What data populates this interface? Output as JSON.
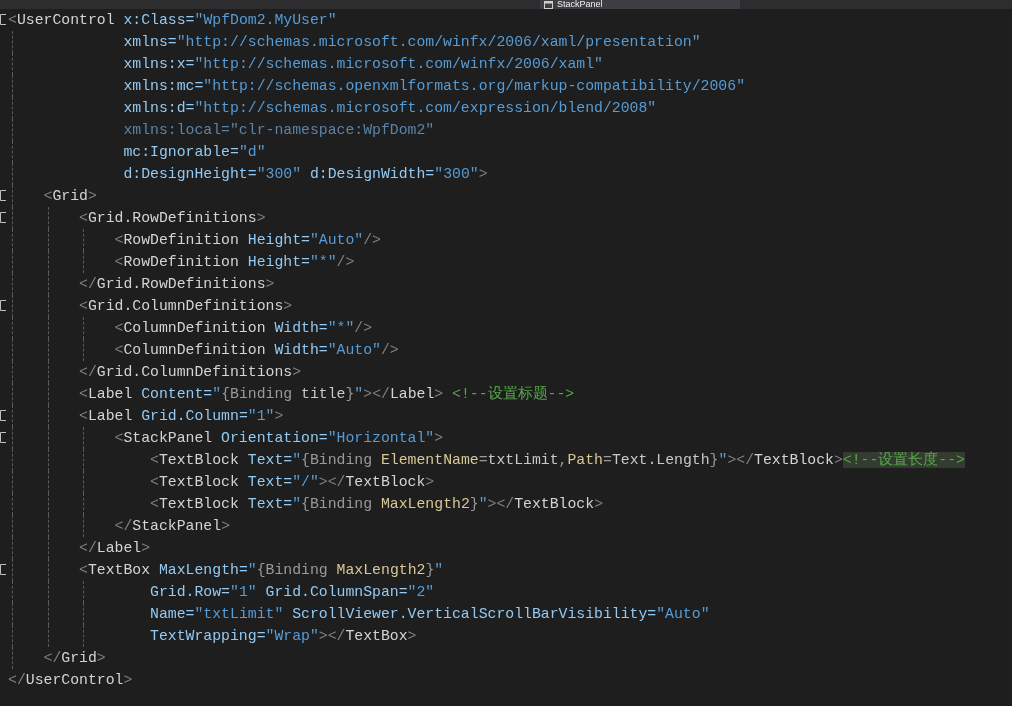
{
  "document_tab": {
    "label": "StackPanel"
  },
  "lines": [
    {
      "expanded": true,
      "tokens": [
        {
          "kind": "punct",
          "text": "<"
        },
        {
          "kind": "tag",
          "text": "UserControl"
        },
        {
          "kind": "attr",
          "text": " x:Class="
        },
        {
          "kind": "value",
          "text": "\"WpfDom2.MyUser\""
        }
      ]
    },
    {
      "tokens": [
        {
          "kind": "attr",
          "text": "             xmlns="
        },
        {
          "kind": "value",
          "text": "\"http://schemas.microsoft.com/winfx/2006/xaml/presentation\""
        }
      ]
    },
    {
      "tokens": [
        {
          "kind": "attr",
          "text": "             xmlns:x="
        },
        {
          "kind": "value",
          "text": "\"http://schemas.microsoft.com/winfx/2006/xaml\""
        }
      ]
    },
    {
      "tokens": [
        {
          "kind": "attr",
          "text": "             xmlns:mc="
        },
        {
          "kind": "value",
          "text": "\"http://schemas.openxmlformats.org/markup-compatibility/2006\""
        }
      ]
    },
    {
      "tokens": [
        {
          "kind": "attr",
          "text": "             xmlns:d="
        },
        {
          "kind": "value",
          "text": "\"http://schemas.microsoft.com/expression/blend/2008\""
        }
      ]
    },
    {
      "tokens": [
        {
          "kind": "unused",
          "text": "             xmlns:local=\"clr-namespace:WpfDom2\""
        }
      ]
    },
    {
      "tokens": [
        {
          "kind": "attr",
          "text": "             mc:Ignorable="
        },
        {
          "kind": "value",
          "text": "\"d\""
        }
      ]
    },
    {
      "tokens": [
        {
          "kind": "attr",
          "text": "             d:DesignHeight="
        },
        {
          "kind": "value",
          "text": "\"300\""
        },
        {
          "kind": "attr",
          "text": " d:DesignWidth="
        },
        {
          "kind": "value",
          "text": "\"300\""
        },
        {
          "kind": "punct",
          "text": ">"
        }
      ]
    },
    {
      "expanded": true,
      "tokens": [
        {
          "kind": "punct",
          "text": "    <"
        },
        {
          "kind": "tag",
          "text": "Grid"
        },
        {
          "kind": "punct",
          "text": ">"
        }
      ]
    },
    {
      "expanded": true,
      "tokens": [
        {
          "kind": "punct",
          "text": "        <"
        },
        {
          "kind": "tag",
          "text": "Grid.RowDefinitions"
        },
        {
          "kind": "punct",
          "text": ">"
        }
      ]
    },
    {
      "tokens": [
        {
          "kind": "punct",
          "text": "            <"
        },
        {
          "kind": "tag",
          "text": "RowDefinition"
        },
        {
          "kind": "attr",
          "text": " Height="
        },
        {
          "kind": "value",
          "text": "\"Auto\""
        },
        {
          "kind": "punct",
          "text": "/>"
        }
      ]
    },
    {
      "tokens": [
        {
          "kind": "punct",
          "text": "            <"
        },
        {
          "kind": "tag",
          "text": "RowDefinition"
        },
        {
          "kind": "attr",
          "text": " Height="
        },
        {
          "kind": "value",
          "text": "\"*\""
        },
        {
          "kind": "punct",
          "text": "/>"
        }
      ]
    },
    {
      "tokens": [
        {
          "kind": "punct",
          "text": "        </"
        },
        {
          "kind": "tag",
          "text": "Grid.RowDefinitions"
        },
        {
          "kind": "punct",
          "text": ">"
        }
      ]
    },
    {
      "expanded": true,
      "tokens": [
        {
          "kind": "punct",
          "text": "        <"
        },
        {
          "kind": "tag",
          "text": "Grid.ColumnDefinitions"
        },
        {
          "kind": "punct",
          "text": ">"
        }
      ]
    },
    {
      "tokens": [
        {
          "kind": "punct",
          "text": "            <"
        },
        {
          "kind": "tag",
          "text": "ColumnDefinition"
        },
        {
          "kind": "attr",
          "text": " Width="
        },
        {
          "kind": "value",
          "text": "\"*\""
        },
        {
          "kind": "punct",
          "text": "/>"
        }
      ]
    },
    {
      "tokens": [
        {
          "kind": "punct",
          "text": "            <"
        },
        {
          "kind": "tag",
          "text": "ColumnDefinition"
        },
        {
          "kind": "attr",
          "text": " Width="
        },
        {
          "kind": "value",
          "text": "\"Auto\""
        },
        {
          "kind": "punct",
          "text": "/>"
        }
      ]
    },
    {
      "tokens": [
        {
          "kind": "punct",
          "text": "        </"
        },
        {
          "kind": "tag",
          "text": "Grid.ColumnDefinitions"
        },
        {
          "kind": "punct",
          "text": ">"
        }
      ]
    },
    {
      "tokens": [
        {
          "kind": "punct",
          "text": "        <"
        },
        {
          "kind": "tag",
          "text": "Label"
        },
        {
          "kind": "attr",
          "text": " Content="
        },
        {
          "kind": "value",
          "text": "\""
        },
        {
          "kind": "markup",
          "text": "{Binding"
        },
        {
          "kind": "markup_value",
          "text": " title"
        },
        {
          "kind": "markup",
          "text": "}"
        },
        {
          "kind": "value",
          "text": "\""
        },
        {
          "kind": "punct",
          "text": "></"
        },
        {
          "kind": "tag",
          "text": "Label"
        },
        {
          "kind": "punct",
          "text": ">"
        },
        {
          "kind": "comment",
          "text": " <!--设置标题-->"
        }
      ]
    },
    {
      "expanded": true,
      "tokens": [
        {
          "kind": "punct",
          "text": "        <"
        },
        {
          "kind": "tag",
          "text": "Label"
        },
        {
          "kind": "attr",
          "text": " Grid.Column="
        },
        {
          "kind": "value",
          "text": "\"1\""
        },
        {
          "kind": "punct",
          "text": ">"
        }
      ]
    },
    {
      "expanded": true,
      "tokens": [
        {
          "kind": "punct",
          "text": "            <"
        },
        {
          "kind": "tag",
          "text": "StackPanel"
        },
        {
          "kind": "attr",
          "text": " Orientation="
        },
        {
          "kind": "value",
          "text": "\"Horizontal\""
        },
        {
          "kind": "punct",
          "text": ">"
        }
      ]
    },
    {
      "tokens": [
        {
          "kind": "punct",
          "text": "                <"
        },
        {
          "kind": "tag",
          "text": "TextBlock"
        },
        {
          "kind": "attr",
          "text": " Text="
        },
        {
          "kind": "value",
          "text": "\""
        },
        {
          "kind": "markup",
          "text": "{Binding"
        },
        {
          "kind": "markup_property",
          "text": " ElementName"
        },
        {
          "kind": "markup",
          "text": "="
        },
        {
          "kind": "markup_value",
          "text": "txtLimit"
        },
        {
          "kind": "markup",
          "text": ","
        },
        {
          "kind": "markup_property",
          "text": "Path"
        },
        {
          "kind": "markup",
          "text": "="
        },
        {
          "kind": "markup_value",
          "text": "Text.Length"
        },
        {
          "kind": "markup",
          "text": "}"
        },
        {
          "kind": "value",
          "text": "\""
        },
        {
          "kind": "punct",
          "text": "></"
        },
        {
          "kind": "tag",
          "text": "TextBlock"
        },
        {
          "kind": "punct",
          "text": ">"
        },
        {
          "kind": "comment_highlighted",
          "text": "<!--设置长度-->"
        }
      ]
    },
    {
      "tokens": [
        {
          "kind": "punct",
          "text": "                <"
        },
        {
          "kind": "tag",
          "text": "TextBlock"
        },
        {
          "kind": "attr",
          "text": " Text="
        },
        {
          "kind": "value",
          "text": "\"/\""
        },
        {
          "kind": "punct",
          "text": "></"
        },
        {
          "kind": "tag",
          "text": "TextBlock"
        },
        {
          "kind": "punct",
          "text": ">"
        }
      ]
    },
    {
      "tokens": [
        {
          "kind": "punct",
          "text": "                <"
        },
        {
          "kind": "tag",
          "text": "TextBlock"
        },
        {
          "kind": "attr",
          "text": " Text="
        },
        {
          "kind": "value",
          "text": "\""
        },
        {
          "kind": "markup",
          "text": "{Binding"
        },
        {
          "kind": "markup_property",
          "text": " MaxLength2"
        },
        {
          "kind": "markup",
          "text": "}"
        },
        {
          "kind": "value",
          "text": "\""
        },
        {
          "kind": "punct",
          "text": "></"
        },
        {
          "kind": "tag",
          "text": "TextBlock"
        },
        {
          "kind": "punct",
          "text": ">"
        }
      ]
    },
    {
      "tokens": [
        {
          "kind": "punct",
          "text": "            </"
        },
        {
          "kind": "tag",
          "text": "StackPanel"
        },
        {
          "kind": "punct",
          "text": ">"
        }
      ]
    },
    {
      "tokens": [
        {
          "kind": "punct",
          "text": "        </"
        },
        {
          "kind": "tag",
          "text": "Label"
        },
        {
          "kind": "punct",
          "text": ">"
        }
      ]
    },
    {
      "expanded": true,
      "tokens": [
        {
          "kind": "punct",
          "text": "        <"
        },
        {
          "kind": "tag",
          "text": "TextBox"
        },
        {
          "kind": "attr",
          "text": " MaxLength="
        },
        {
          "kind": "value",
          "text": "\""
        },
        {
          "kind": "markup",
          "text": "{Binding"
        },
        {
          "kind": "markup_property",
          "text": " MaxLength2"
        },
        {
          "kind": "markup",
          "text": "}"
        },
        {
          "kind": "value",
          "text": "\""
        }
      ]
    },
    {
      "tokens": [
        {
          "kind": "attr",
          "text": "                Grid.Row="
        },
        {
          "kind": "value",
          "text": "\"1\""
        },
        {
          "kind": "attr",
          "text": " Grid.ColumnSpan="
        },
        {
          "kind": "value",
          "text": "\"2\""
        }
      ]
    },
    {
      "tokens": [
        {
          "kind": "attr",
          "text": "                Name="
        },
        {
          "kind": "value",
          "text": "\"txtLimit\""
        },
        {
          "kind": "attr",
          "text": " ScrollViewer.VerticalScrollBarVisibility="
        },
        {
          "kind": "value",
          "text": "\"Auto\""
        }
      ]
    },
    {
      "tokens": [
        {
          "kind": "attr",
          "text": "                TextWrapping="
        },
        {
          "kind": "value",
          "text": "\"Wrap\""
        },
        {
          "kind": "punct",
          "text": "></"
        },
        {
          "kind": "tag",
          "text": "TextBox"
        },
        {
          "kind": "punct",
          "text": ">"
        }
      ]
    },
    {
      "tokens": [
        {
          "kind": "punct",
          "text": "    </"
        },
        {
          "kind": "tag",
          "text": "Grid"
        },
        {
          "kind": "punct",
          "text": ">"
        }
      ]
    },
    {
      "tokens": [
        {
          "kind": "punct",
          "text": "</"
        },
        {
          "kind": "tag",
          "text": "UserControl"
        },
        {
          "kind": "punct",
          "text": ">"
        }
      ]
    }
  ]
}
